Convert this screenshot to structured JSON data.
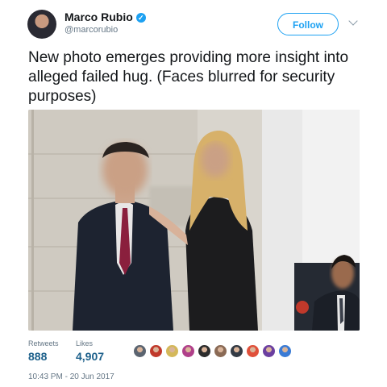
{
  "user": {
    "name": "Marco Rubio",
    "handle": "@marcorubio",
    "verified_mark": "✓"
  },
  "follow_label": "Follow",
  "tweet_text": "New photo emerges providing more insight into alleged failed hug. (Faces blurred for security purposes)",
  "stats": [
    {
      "label": "Retweets",
      "value": "888"
    },
    {
      "label": "Likes",
      "value": "4,907"
    }
  ],
  "liker_avatars": [
    {
      "color": "#5b6470",
      "icon": "user-avatar-icon"
    },
    {
      "color": "#c0392b",
      "icon": "user-avatar-icon"
    },
    {
      "color": "#d4b85a",
      "icon": "user-avatar-icon"
    },
    {
      "color": "#b0408a",
      "icon": "user-avatar-icon"
    },
    {
      "color": "#2c2c2c",
      "icon": "user-avatar-icon"
    },
    {
      "color": "#8a6a55",
      "icon": "user-avatar-icon"
    },
    {
      "color": "#333a44",
      "icon": "user-avatar-icon"
    },
    {
      "color": "#e0503a",
      "icon": "user-avatar-icon"
    },
    {
      "color": "#6b3fa0",
      "icon": "user-avatar-icon"
    },
    {
      "color": "#3a7bd5",
      "icon": "user-avatar-icon"
    }
  ],
  "timestamp": "10:43 PM - 20 Jun 2017",
  "colors": {
    "accent": "#1da1f2",
    "text": "#14171a",
    "muted": "#657786",
    "stat_value": "#1b5f8a"
  }
}
